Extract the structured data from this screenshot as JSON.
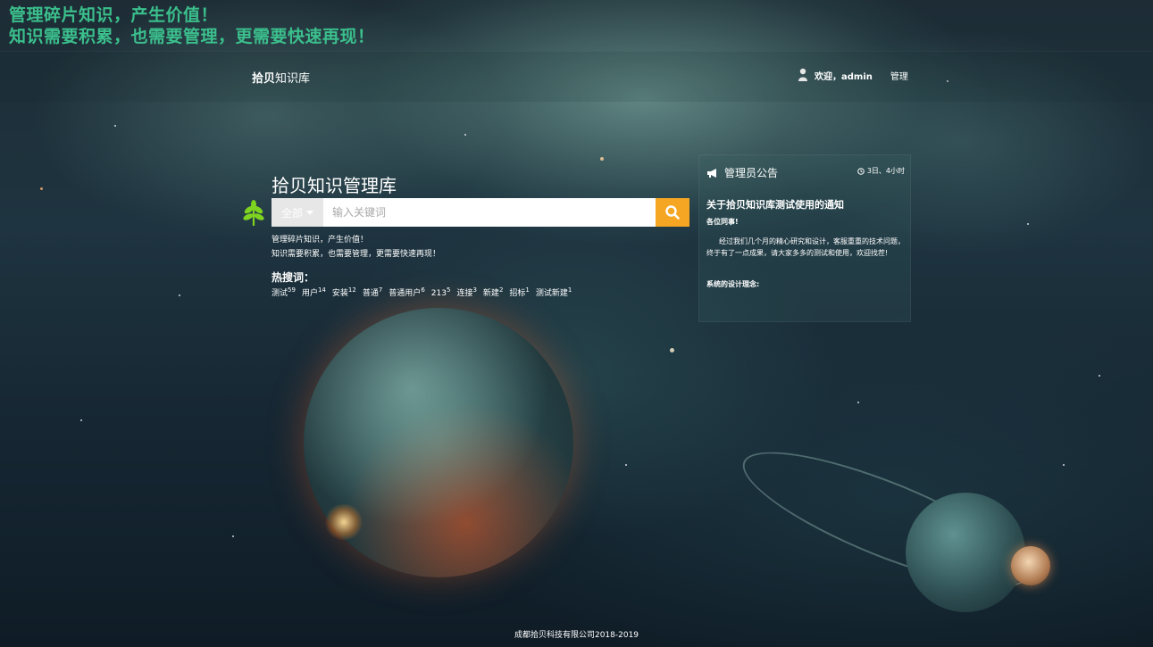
{
  "slogan": {
    "line1": "管理碎片知识，产生价值！",
    "line2": "知识需要积累，也需要管理，更需要快速再现！"
  },
  "header": {
    "brand_bold": "拾贝",
    "brand_rest": "知识库",
    "welcome": "欢迎，admin",
    "manage_link": "管理"
  },
  "search": {
    "title": "拾贝知识管理库",
    "scope_label": "全部",
    "placeholder": "输入关键词",
    "tagline1": "管理碎片知识，产生价值！",
    "tagline2": "知识需要积累，也需要管理，更需要快速再现！"
  },
  "hot": {
    "title": "热搜词：",
    "items": [
      {
        "word": "测试",
        "count": "59"
      },
      {
        "word": "用户",
        "count": "14"
      },
      {
        "word": "安装",
        "count": "12"
      },
      {
        "word": "普通",
        "count": "7"
      },
      {
        "word": "普通用户",
        "count": "6"
      },
      {
        "word": "213",
        "count": "5"
      },
      {
        "word": "连接",
        "count": "3"
      },
      {
        "word": "新建",
        "count": "2"
      },
      {
        "word": "招标",
        "count": "1"
      },
      {
        "word": "测试新建",
        "count": "1"
      }
    ]
  },
  "notice": {
    "header": "管理员公告",
    "time": "3日、4小时",
    "title": "关于拾贝知识库测试使用的通知",
    "greeting": "各位同事!",
    "body": "经过我们几个月的精心研究和设计，客服重重的技术问题，终于有了一点成果，请大家多多的测试和使用，欢迎找茬!",
    "concept": "系统的设计理念:"
  },
  "footer": {
    "copyright": "成都拾贝科技有限公司2018-2019"
  },
  "colors": {
    "slogan": "#3bbf8c",
    "search_button": "#f5a623",
    "leaf": "#7ed321"
  }
}
